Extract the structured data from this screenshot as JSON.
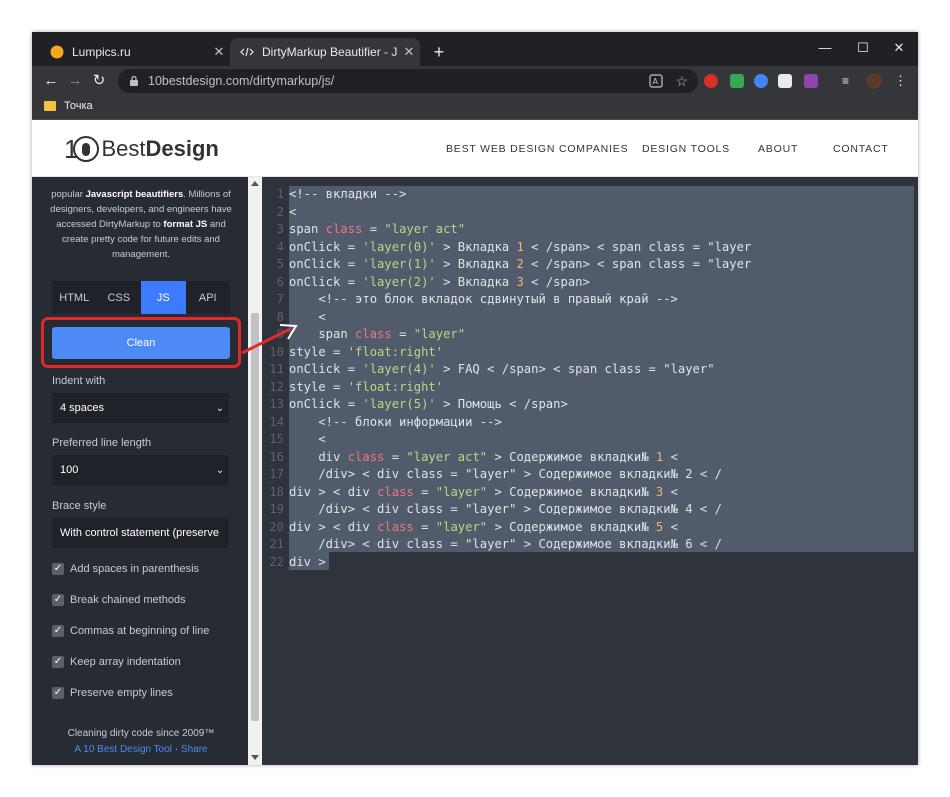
{
  "browser": {
    "tabs": [
      {
        "title": "Lumpics.ru",
        "active": false
      },
      {
        "title": "DirtyMarkup Beautifier - Javascrip",
        "active": true
      }
    ],
    "new_tab": "+",
    "window_controls": {
      "minimize": "—",
      "maximize": "☐",
      "close": "✕"
    },
    "url": "10bestdesign.com/dirtymarkup/js/",
    "bookmarks": [
      {
        "label": "Точка"
      }
    ]
  },
  "site": {
    "logo": {
      "ten": "10",
      "best": "Best",
      "design": "Design"
    },
    "nav": [
      "BEST WEB DESIGN COMPANIES",
      "DESIGN TOOLS",
      "ABOUT",
      "CONTACT"
    ]
  },
  "sidebar": {
    "intro_pre": "popular ",
    "intro_bold1": "Javascript beautifiers",
    "intro_mid": ". Millions of designers, developers, and engineers have accessed DirtyMarkup to ",
    "intro_bold2": "format JS",
    "intro_post": " and create pretty code for future edits and management.",
    "lang_tabs": [
      "HTML",
      "CSS",
      "JS",
      "API"
    ],
    "active_tab": "JS",
    "clean_label": "Clean",
    "indent_label": "Indent with",
    "indent_value": "4 spaces",
    "line_length_label": "Preferred line length",
    "line_length_value": "100",
    "brace_label": "Brace style",
    "brace_value": "With control statement (preserve",
    "checkboxes": [
      {
        "label": "Add spaces in parenthesis",
        "checked": true
      },
      {
        "label": "Break chained methods",
        "checked": true
      },
      {
        "label": "Commas at beginning of line",
        "checked": true
      },
      {
        "label": "Keep array indentation",
        "checked": true
      },
      {
        "label": "Preserve empty lines",
        "checked": true
      }
    ],
    "footer_line1": "Cleaning dirty code since 2009™",
    "footer_link1": "A 10 Best Design Tool",
    "footer_sep": " · ",
    "footer_link2": "Share"
  },
  "editor": {
    "lines": [
      {
        "n": "1",
        "segs": [
          [
            "c-com",
            "<!-- вкладки -->"
          ]
        ]
      },
      {
        "n": "2",
        "segs": [
          [
            "c-tag",
            "<"
          ]
        ]
      },
      {
        "n": "3",
        "segs": [
          [
            "c-tag",
            "span "
          ],
          [
            "c-kw",
            "class"
          ],
          [
            "c-tag",
            " = "
          ],
          [
            "c-str",
            "\"layer act\""
          ]
        ]
      },
      {
        "n": "4",
        "segs": [
          [
            "c-tag",
            "onClick = "
          ],
          [
            "c-str",
            "'layer(0)'"
          ],
          [
            "c-tag",
            " > Вкладка "
          ],
          [
            "c-num",
            "1"
          ],
          [
            "c-tag",
            " < /span> < span class = \"layer"
          ]
        ]
      },
      {
        "n": "5",
        "segs": [
          [
            "c-tag",
            "onClick = "
          ],
          [
            "c-str",
            "'layer(1)'"
          ],
          [
            "c-tag",
            " > Вкладка "
          ],
          [
            "c-num",
            "2"
          ],
          [
            "c-tag",
            " < /span> < span class = \"layer"
          ]
        ]
      },
      {
        "n": "6",
        "segs": [
          [
            "c-tag",
            "onClick = "
          ],
          [
            "c-str",
            "'layer(2)'"
          ],
          [
            "c-tag",
            " > Вкладка "
          ],
          [
            "c-num",
            "3"
          ],
          [
            "c-tag",
            " < /span>"
          ]
        ]
      },
      {
        "n": "7",
        "segs": [
          [
            "c-com",
            "    <!-- это блок вкладок сдвинутый в правый край -->"
          ]
        ]
      },
      {
        "n": "8",
        "segs": [
          [
            "c-tag",
            "    <"
          ]
        ]
      },
      {
        "n": "9",
        "segs": [
          [
            "c-tag",
            "    span "
          ],
          [
            "c-kw",
            "class"
          ],
          [
            "c-tag",
            " = "
          ],
          [
            "c-str",
            "\"layer\""
          ]
        ]
      },
      {
        "n": "10",
        "segs": [
          [
            "c-tag",
            "style = "
          ],
          [
            "c-str",
            "'float:right'"
          ]
        ]
      },
      {
        "n": "11",
        "segs": [
          [
            "c-tag",
            "onClick = "
          ],
          [
            "c-str",
            "'layer(4)'"
          ],
          [
            "c-tag",
            " > FAQ < /span> < span class = \"layer\""
          ]
        ]
      },
      {
        "n": "12",
        "segs": [
          [
            "c-tag",
            "style = "
          ],
          [
            "c-str",
            "'float:right'"
          ]
        ]
      },
      {
        "n": "13",
        "segs": [
          [
            "c-tag",
            "onClick = "
          ],
          [
            "c-str",
            "'layer(5)'"
          ],
          [
            "c-tag",
            " > Помощь < /span>"
          ]
        ]
      },
      {
        "n": "14",
        "segs": [
          [
            "c-com",
            "    <!-- блоки информации -->"
          ]
        ]
      },
      {
        "n": "15",
        "segs": [
          [
            "c-tag",
            "    <"
          ]
        ]
      },
      {
        "n": "16",
        "segs": [
          [
            "c-tag",
            "    div "
          ],
          [
            "c-kw",
            "class"
          ],
          [
            "c-tag",
            " = "
          ],
          [
            "c-str",
            "\"layer act\""
          ],
          [
            "c-tag",
            " > Содержимое вкладки№ "
          ],
          [
            "c-num",
            "1"
          ],
          [
            "c-tag",
            " <"
          ]
        ]
      },
      {
        "n": "17",
        "segs": [
          [
            "c-tag",
            "    /div> < div class = \"layer\" > Содержимое вкладки№ 2 < /"
          ]
        ]
      },
      {
        "n": "18",
        "segs": [
          [
            "c-tag",
            "div > < div "
          ],
          [
            "c-kw",
            "class"
          ],
          [
            "c-tag",
            " = "
          ],
          [
            "c-str",
            "\"layer\""
          ],
          [
            "c-tag",
            " > Содержимое вкладки№ "
          ],
          [
            "c-num",
            "3"
          ],
          [
            "c-tag",
            " <"
          ]
        ]
      },
      {
        "n": "19",
        "segs": [
          [
            "c-tag",
            "    /div> < div class = \"layer\" > Содержимое вкладки№ 4 < /"
          ]
        ]
      },
      {
        "n": "20",
        "segs": [
          [
            "c-tag",
            "div > < div "
          ],
          [
            "c-kw",
            "class"
          ],
          [
            "c-tag",
            " = "
          ],
          [
            "c-str",
            "\"layer\""
          ],
          [
            "c-tag",
            " > Содержимое вкладки№ "
          ],
          [
            "c-num",
            "5"
          ],
          [
            "c-tag",
            " <"
          ]
        ]
      },
      {
        "n": "21",
        "segs": [
          [
            "c-tag",
            "    /div> < div class = \"layer\" > Содержимое вкладки№ 6 < /"
          ]
        ]
      },
      {
        "n": "22",
        "segs": [
          [
            "c-tag",
            "div >"
          ]
        ]
      }
    ]
  },
  "colors": {
    "accent": "#4e8af5",
    "highlight_annotation": "#e02a2a",
    "editor_bg": "#2f333b",
    "sidebar_bg": "#272b33"
  }
}
